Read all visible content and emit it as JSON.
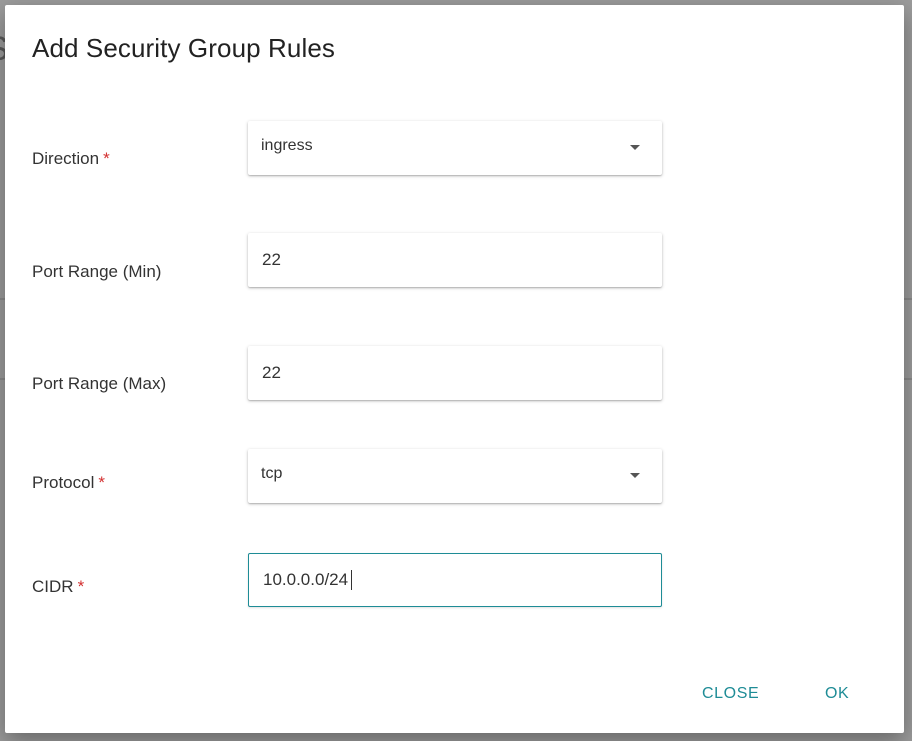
{
  "dialog": {
    "title": "Add Security Group Rules"
  },
  "form": {
    "direction": {
      "label": "Direction",
      "required_mark": "*",
      "value": "ingress"
    },
    "port_range_min": {
      "label": "Port Range (Min)",
      "value": "22"
    },
    "port_range_max": {
      "label": "Port Range (Max)",
      "value": "22"
    },
    "protocol": {
      "label": "Protocol",
      "required_mark": "*",
      "value": "tcp"
    },
    "cidr": {
      "label": "CIDR",
      "required_mark": "*",
      "value": "10.0.0.0/24"
    }
  },
  "actions": {
    "close_label": "CLOSE",
    "ok_label": "OK"
  },
  "colors": {
    "accent": "#1e8c96",
    "required": "#d32f2f",
    "dialog_background": "#ffffff",
    "backdrop": "#9c9c9c"
  },
  "icons": {
    "dropdown": "caret-down-icon"
  }
}
